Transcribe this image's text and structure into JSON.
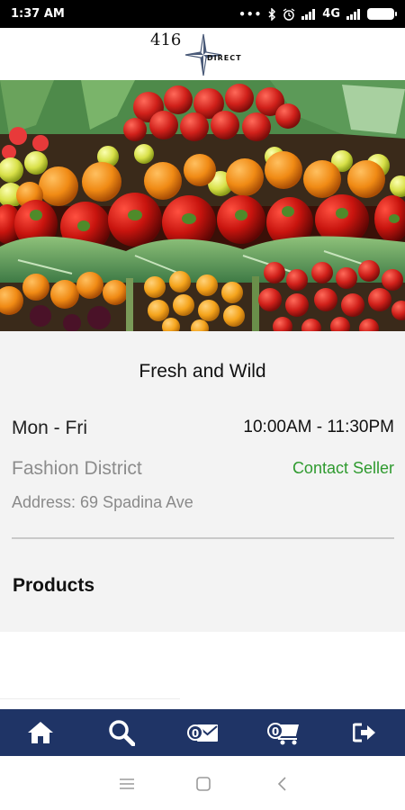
{
  "status_bar": {
    "time": "1:37 AM",
    "network": "4G",
    "icons": [
      "dots-icon",
      "bluetooth-icon",
      "alarm-icon",
      "signal-icon",
      "signal-icon",
      "battery-icon"
    ]
  },
  "header": {
    "logo_number": "416",
    "logo_text": "DIRECT"
  },
  "hero": {
    "icon": "produce-photo"
  },
  "store": {
    "name": "Fresh and Wild",
    "days": "Mon - Fri",
    "hours": "10:00AM - 11:30PM",
    "district": "Fashion District",
    "contact_label": "Contact Seller",
    "address": "Address: 69 Spadina Ave"
  },
  "sections": {
    "products_title": "Products"
  },
  "bottom_nav": {
    "items": [
      {
        "icon": "home-icon"
      },
      {
        "icon": "search-icon"
      },
      {
        "icon": "mail-icon",
        "badge": "0"
      },
      {
        "icon": "cart-icon",
        "badge": "0"
      },
      {
        "icon": "logout-icon"
      }
    ]
  },
  "colors": {
    "nav_bg": "#1f3466",
    "contact_green": "#2e9a2e",
    "panel_bg": "#f3f3f3"
  }
}
